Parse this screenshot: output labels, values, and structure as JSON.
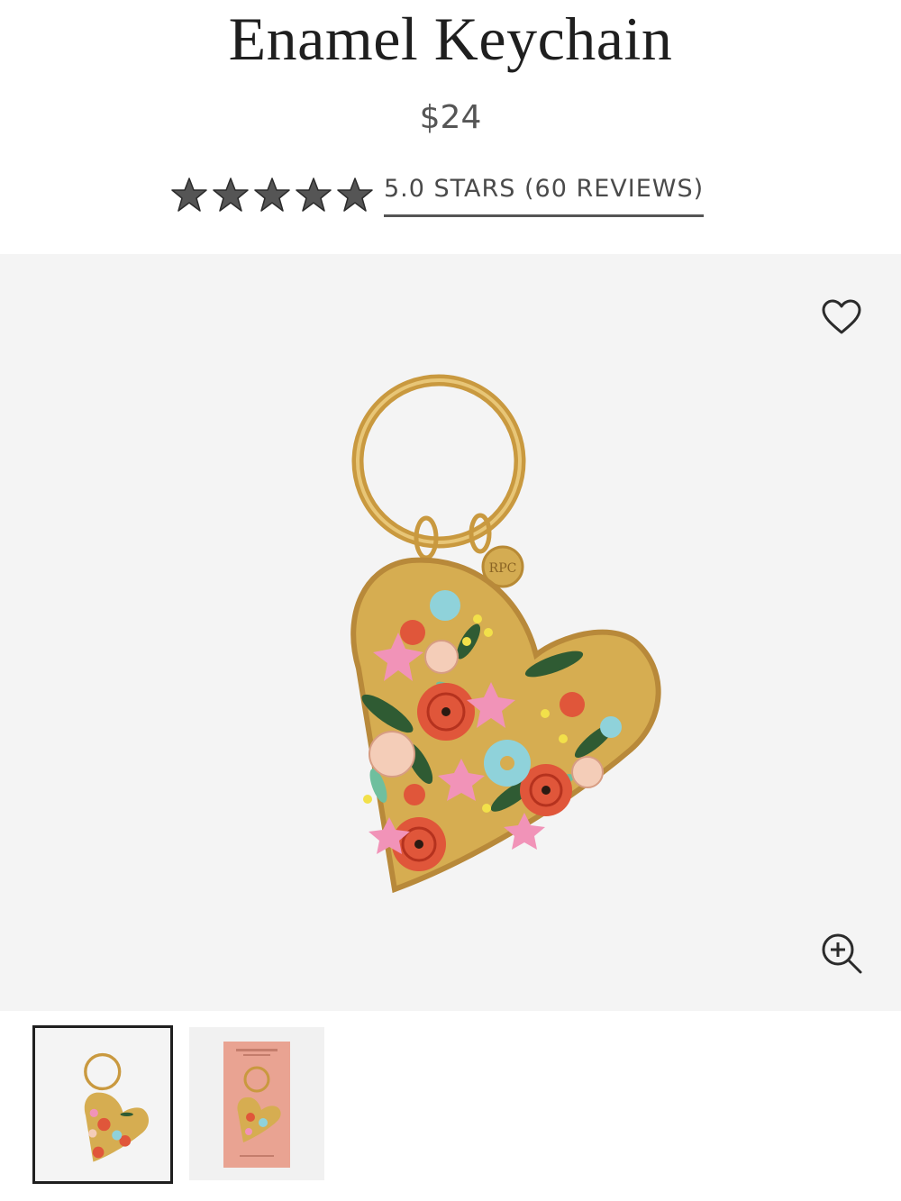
{
  "product": {
    "title": "Enamel Keychain",
    "price": "$24",
    "rating": {
      "stars": 5,
      "max_stars": 5,
      "text": "5.0 STARS (60 REVIEWS)"
    }
  },
  "gallery": {
    "background": "#f4f4f4",
    "wishlist_icon": "heart-outline-icon",
    "zoom_icon": "zoom-in-icon",
    "thumbnails": [
      {
        "name": "keychain-front",
        "selected": true
      },
      {
        "name": "keychain-packaging",
        "selected": false
      }
    ]
  },
  "colors": {
    "star": "#555555",
    "gold": "#d4ac52",
    "thumb_card": "#e9a392"
  }
}
